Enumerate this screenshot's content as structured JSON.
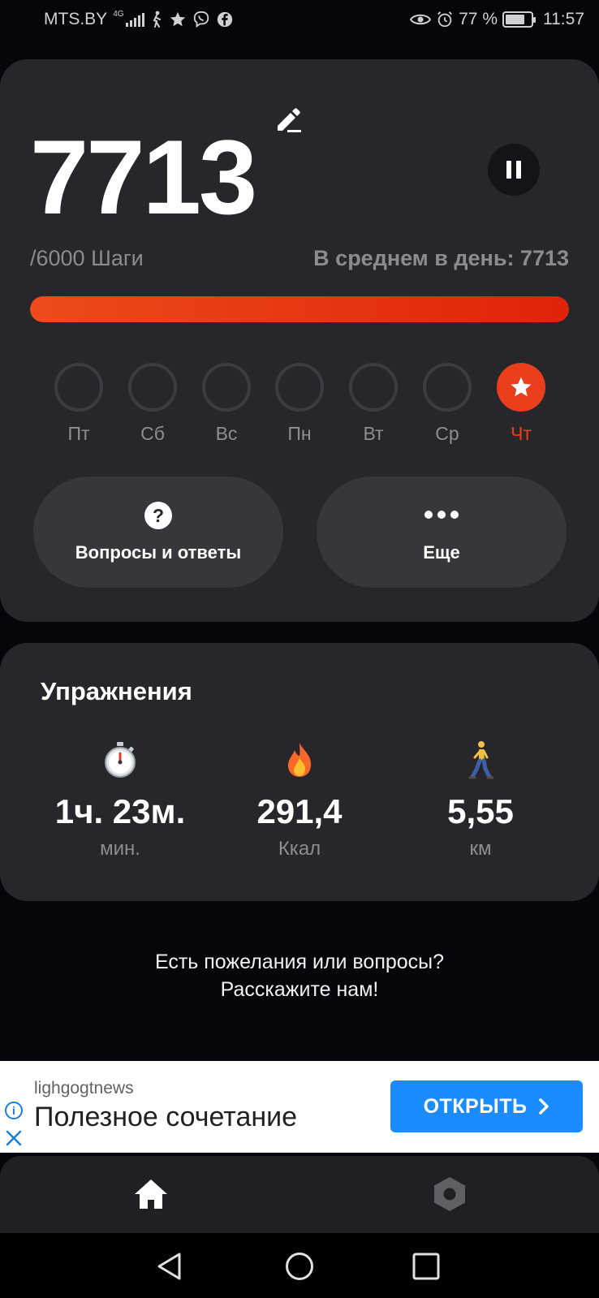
{
  "status_bar": {
    "carrier": "MTS.BY",
    "network": "4G",
    "battery_percent": "77 %",
    "battery_level": 0.77,
    "time": "11:57"
  },
  "steps": {
    "count": "7713",
    "goal": "/6000 Шаги",
    "average": "В среднем в день: 7713",
    "progress": 1.0,
    "icons": {
      "edit": "pencil-icon",
      "pause": "pause-icon"
    }
  },
  "week": {
    "days": [
      {
        "label": "Пт",
        "done": false
      },
      {
        "label": "Сб",
        "done": false
      },
      {
        "label": "Вс",
        "done": false
      },
      {
        "label": "Пн",
        "done": false
      },
      {
        "label": "Вт",
        "done": false
      },
      {
        "label": "Ср",
        "done": false
      },
      {
        "label": "Чт",
        "done": true
      }
    ]
  },
  "actions": {
    "faq_label": "Вопросы и ответы",
    "more_label": "Еще"
  },
  "exercise": {
    "title": "Упражнения",
    "stats": [
      {
        "icon": "stopwatch-icon",
        "value": "1ч. 23м.",
        "unit": "мин."
      },
      {
        "icon": "fire-icon",
        "value": "291,4",
        "unit": "Ккал"
      },
      {
        "icon": "walking-person-icon",
        "value": "5,55",
        "unit": "км"
      }
    ]
  },
  "feedback": {
    "line1": "Есть пожелания или вопросы?",
    "line2": "Расскажите нам!"
  },
  "ad": {
    "brand": "lighgogtnews",
    "headline": "Полезное сочетание",
    "button_label": "ОТКРЫТЬ",
    "info_glyph": "i"
  },
  "colors": {
    "accent": "#ea3e1c",
    "card": "#27272b",
    "background": "#05050c",
    "ad_button": "#1a8cff"
  }
}
